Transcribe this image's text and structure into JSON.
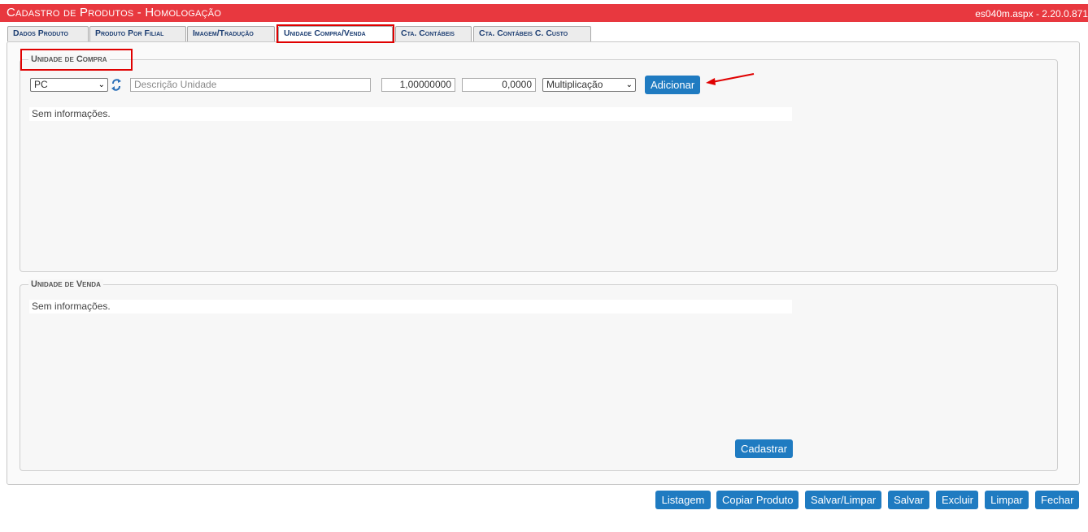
{
  "header": {
    "title": "Cadastro de Produtos  - Homologação",
    "version": "es040m.aspx - 2.20.0.871"
  },
  "tabs": [
    {
      "label": "Dados Produto"
    },
    {
      "label": "Produto Por Filial"
    },
    {
      "label": "Imagem/Tradução"
    },
    {
      "label": "Unidade Compra/Venda",
      "active": true
    },
    {
      "label": "Cta. Contábeis"
    },
    {
      "label": "Cta. Contábeis C. Custo"
    }
  ],
  "compra": {
    "legend": "Unidade de Compra",
    "unit_select": "PC",
    "unit_chevron": "⌄",
    "descricao_placeholder": "Descrição Unidade",
    "fator": "1,00000000",
    "valor": "0,0000",
    "operacao": "Multiplicação",
    "operacao_chevron": "⌄",
    "add_label": "Adicionar",
    "empty_text": "Sem informações."
  },
  "venda": {
    "legend": "Unidade de Venda",
    "empty_text": "Sem informações.",
    "cadastrar_label": "Cadastrar"
  },
  "footer": {
    "listagem": "Listagem",
    "copiar": "Copiar Produto",
    "salvar_limpar": "Salvar/Limpar",
    "salvar": "Salvar",
    "excluir": "Excluir",
    "limpar": "Limpar",
    "fechar": "Fechar"
  },
  "colors": {
    "titlebar": "#e8383f",
    "button": "#1f7bc1",
    "annotation": "#e00000"
  },
  "icons": {
    "refresh": "refresh-icon",
    "arrow": "annotation-arrow-icon"
  }
}
